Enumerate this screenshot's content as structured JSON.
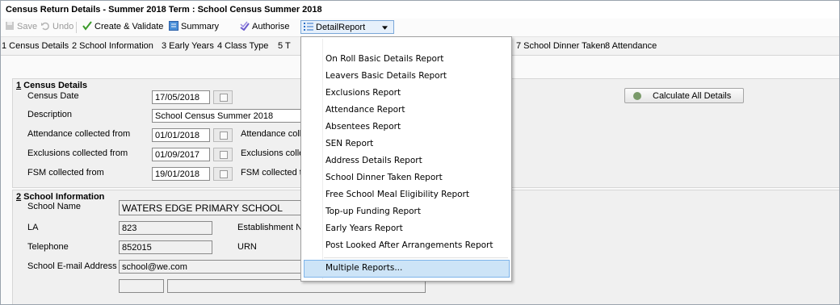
{
  "window": {
    "title": "Census Return Details - Summer 2018 Term : School Census Summer 2018"
  },
  "toolbar": {
    "save": "Save",
    "undo": "Undo",
    "create_validate": "Create & Validate",
    "summary": "Summary",
    "authorise": "Authorise",
    "detail_report": "DetailReport"
  },
  "tabs": [
    "1 Census Details",
    "2 School Information",
    "3 Early Years",
    "4 Class Type",
    "5 T",
    "7 School Dinner Taken",
    "8 Attendance"
  ],
  "census": {
    "section_number": "1",
    "section_title": " Census Details",
    "census_date_label": "Census Date",
    "census_date": "17/05/2018",
    "description_label": "Description",
    "description": "School Census Summer 2018",
    "attendance_from_label": "Attendance collected from",
    "attendance_from": "01/01/2018",
    "attendance_to_label": "Attendance colle",
    "exclusions_from_label": "Exclusions collected from",
    "exclusions_from": "01/09/2017",
    "exclusions_to_label": "Exclusions colle",
    "fsm_from_label": "FSM collected from",
    "fsm_from": "19/01/2018",
    "fsm_to_label": "FSM collected to",
    "calculate_all": "Calculate All Details"
  },
  "school": {
    "section_number": "2",
    "section_title": " School Information",
    "name_label": "School Name",
    "name": "WATERS EDGE PRIMARY SCHOOL",
    "la_label": "LA",
    "la": "823",
    "establishment_label": "Establishment N",
    "telephone_label": "Telephone",
    "telephone": "852015",
    "urn_label": "URN",
    "email_label": "School E-mail Address",
    "email": "school@we.com"
  },
  "menu": {
    "items": [
      "On Roll Basic Details Report",
      "Leavers Basic Details Report",
      "Exclusions Report",
      "Attendance Report",
      "Absentees Report",
      "SEN Report",
      "Address Details Report",
      "School Dinner Taken Report",
      "Free School Meal Eligibility Report",
      "Top-up Funding Report",
      "Early Years Report",
      "Post Looked After Arrangements Report"
    ],
    "multiple": "Multiple Reports..."
  }
}
